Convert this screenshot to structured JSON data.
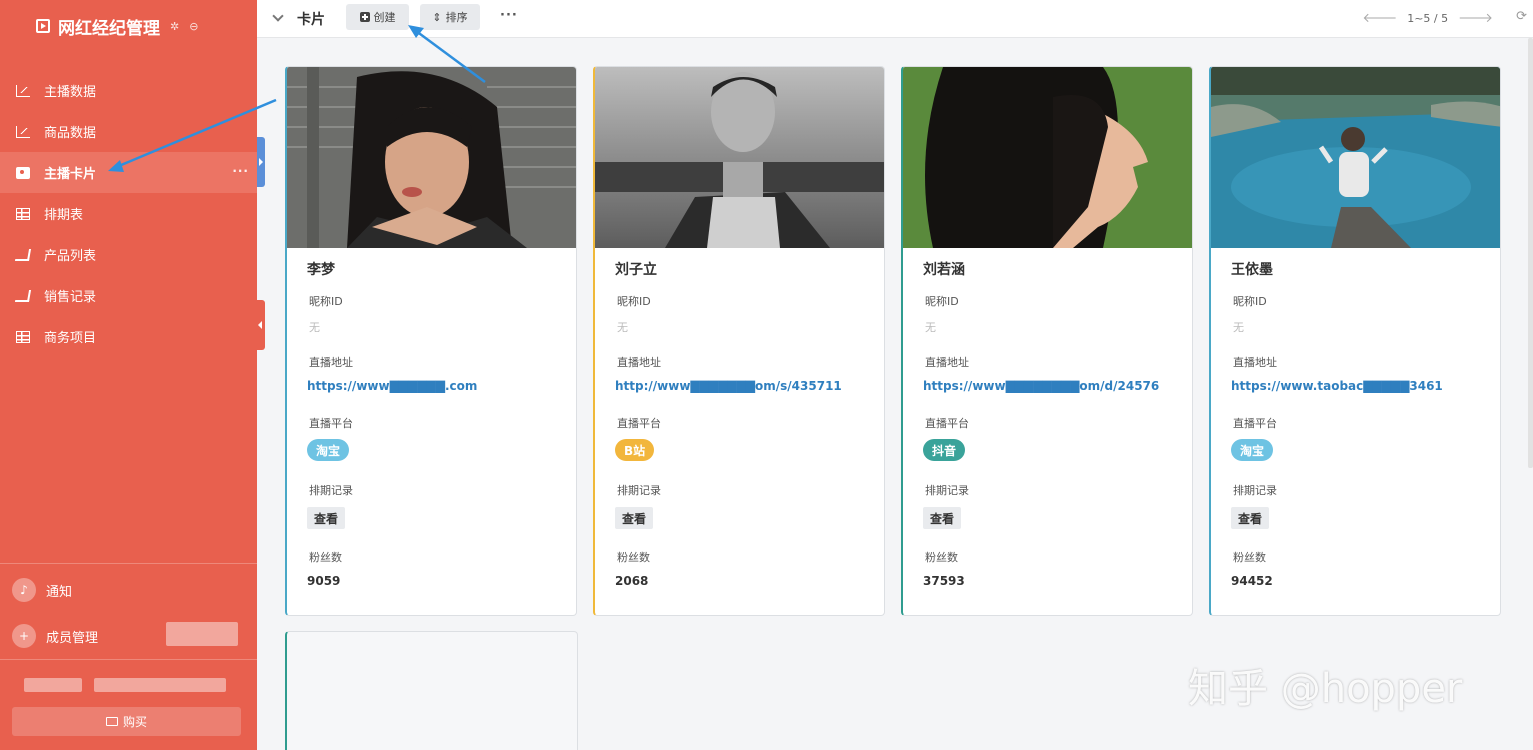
{
  "app": {
    "title": "网红经纪管理"
  },
  "sidebar": {
    "items": [
      {
        "label": "主播数据",
        "icon": "line-chart-icon"
      },
      {
        "label": "商品数据",
        "icon": "line-chart-icon"
      },
      {
        "label": "主播卡片",
        "icon": "contact-card-icon",
        "active": true,
        "more": "···"
      },
      {
        "label": "排期表",
        "icon": "table-grid-icon"
      },
      {
        "label": "产品列表",
        "icon": "cart-icon"
      },
      {
        "label": "销售记录",
        "icon": "cart-icon"
      },
      {
        "label": "商务项目",
        "icon": "table-grid-icon"
      }
    ],
    "notifications_label": "通知",
    "members_label": "成员管理",
    "buy_label": "购买"
  },
  "toolbar": {
    "view_title": "卡片",
    "create_label": "创建",
    "sort_label": "排序",
    "more_label": "···",
    "pager_text": "1~5 / 5"
  },
  "cards": [
    {
      "name": "李梦",
      "nickname_label": "昵称ID",
      "nickname_value": "无",
      "url_label": "直播地址",
      "url_value": "https://www▇▇▇▇▇▇.com",
      "platform_label": "直播平台",
      "platform": "淘宝",
      "platform_color": "#6ec3e3",
      "schedule_label": "排期记录",
      "schedule_button": "查看",
      "fans_label": "粉丝数",
      "fans": "9059"
    },
    {
      "name": "刘子立",
      "nickname_label": "昵称ID",
      "nickname_value": "无",
      "url_label": "直播地址",
      "url_value": "http://www▇▇▇▇▇▇▇om/s/435711",
      "platform_label": "直播平台",
      "platform": "B站",
      "platform_color": "#f2b63c",
      "schedule_label": "排期记录",
      "schedule_button": "查看",
      "fans_label": "粉丝数",
      "fans": "2068"
    },
    {
      "name": "刘若涵",
      "nickname_label": "昵称ID",
      "nickname_value": "无",
      "url_label": "直播地址",
      "url_value": "https://www▇▇▇▇▇▇▇▇om/d/24576",
      "platform_label": "直播平台",
      "platform": "抖音",
      "platform_color": "#3aa39a",
      "schedule_label": "排期记录",
      "schedule_button": "查看",
      "fans_label": "粉丝数",
      "fans": "37593"
    },
    {
      "name": "王依墨",
      "nickname_label": "昵称ID",
      "nickname_value": "无",
      "url_label": "直播地址",
      "url_value": "https://www.taobac▇▇▇▇▇3461",
      "platform_label": "直播平台",
      "platform": "淘宝",
      "platform_color": "#6ec3e3",
      "schedule_label": "排期记录",
      "schedule_button": "查看",
      "fans_label": "粉丝数",
      "fans": "94452"
    }
  ],
  "watermark": "知乎 @hopper",
  "colors": {
    "sidebar_bg": "#e8604e",
    "sidebar_active": "#ec7464",
    "link": "#2f7fbf",
    "annotation_arrow": "#2f8fdd"
  }
}
